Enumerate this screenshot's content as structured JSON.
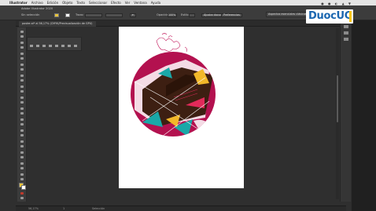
{
  "menubar": {
    "apple": "",
    "app_name": "Illustrator",
    "items": [
      "Archivo",
      "Edición",
      "Objeto",
      "Texto",
      "Seleccionar",
      "Efecto",
      "Ver",
      "Ventana",
      "Ayuda"
    ],
    "tray": "● ● ◐ ▲ ▼"
  },
  "controlbar": {
    "no_selection": "Sin selección",
    "stroke_label": "Trazo:",
    "opacity_label": "Opacidad:",
    "opacity_value": "100%",
    "style_label": "Estilo:",
    "doc_setup": "Ajustar documento",
    "prefs": "Preferencias",
    "window_title": "Adobe Illustrator 2020",
    "workspace": "Aspectos esenciales clásicos",
    "search_placeholder": "Buscar en ayuda Adobe"
  },
  "document": {
    "tab_label": "poster.ai* al 56,17% (CMYK/Previsualización de GPU)"
  },
  "status": {
    "zoom": "56,17%",
    "page": "1",
    "tool": "Selección"
  },
  "logo": {
    "text_a": "Duoc",
    "text_b": "UC"
  },
  "colors": {
    "magenta": "#b3114f",
    "brown": "#3d1f12",
    "teal": "#1aa8a8",
    "yellow": "#f2b82a",
    "logo_blue": "#1a66b0",
    "logo_yellow": "#f7c514"
  }
}
